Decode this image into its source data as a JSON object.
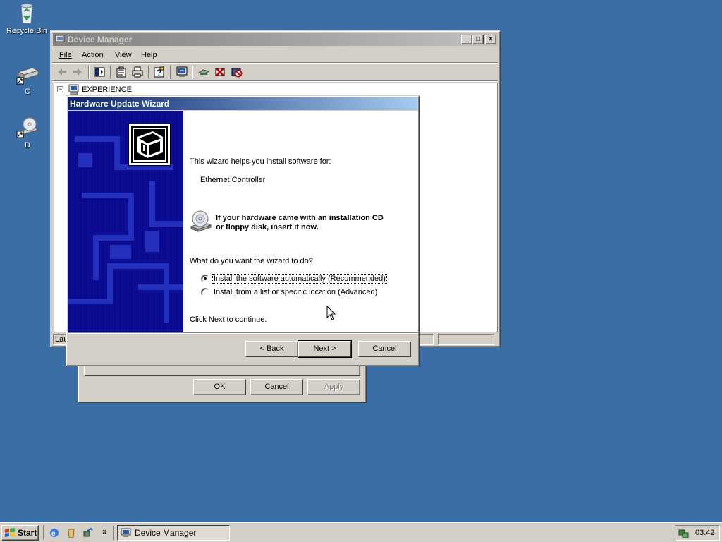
{
  "desktop": {
    "icons": [
      {
        "label": "Recycle Bin"
      },
      {
        "label": "C"
      },
      {
        "label": "D"
      }
    ]
  },
  "device_manager": {
    "title": "Device Manager",
    "menu": {
      "file": "File",
      "action": "Action",
      "view": "View",
      "help": "Help"
    },
    "tree_root": "EXPERIENCE",
    "tree_toggle": "−",
    "status_text": "Lau"
  },
  "properties_dialog": {
    "ok": "OK",
    "cancel": "Cancel",
    "apply": "Apply"
  },
  "wizard": {
    "title": "Hardware Update Wizard",
    "intro": "This wizard helps you install software for:",
    "device": "Ethernet Controller",
    "cd_hint_line1": "If your hardware came with an installation CD",
    "cd_hint_line2": "or floppy disk, insert it now.",
    "question": "What do you want the wizard to do?",
    "options": [
      {
        "label": "Install the software automatically (Recommended)",
        "selected": true
      },
      {
        "label": "Install from a list or specific location (Advanced)",
        "selected": false
      }
    ],
    "footer": "Click Next to continue.",
    "back": "< Back",
    "next": "Next >",
    "cancel": "Cancel"
  },
  "taskbar": {
    "start": "Start",
    "task": "Device Manager",
    "chevron": "»",
    "clock": "03:42"
  },
  "icons": [
    "recycle-bin-icon",
    "drive-c-icon",
    "cd-drive-icon",
    "computer-icon",
    "hardware-icon",
    "cd-disc-icon",
    "cursor-icon"
  ]
}
